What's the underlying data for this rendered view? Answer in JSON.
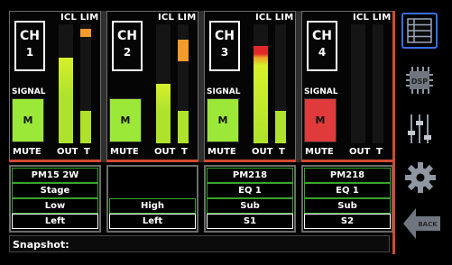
{
  "header": {
    "icl_lim": "ICL LIM"
  },
  "labels": {
    "ch": "CH",
    "signal": "SIGNAL",
    "mute": "MUTE",
    "out": "OUT",
    "t": "T"
  },
  "colors": {
    "meter_green": "#aee22c",
    "meter_yellow": "#d8f02a",
    "peak_orange": "#f39a2c",
    "peak_red": "#e02828",
    "signal_green": "#9be838",
    "signal_red": "#e03a3a",
    "accent_red": "#d04a30",
    "row_border": "#39a32a",
    "selected_icon": "#3a6fe0"
  },
  "channels": [
    {
      "number": "1",
      "signal_symbol": "M",
      "signal_state": "green",
      "out_level": 0.72,
      "t_level": 0.27,
      "lim_indicator": true,
      "out_peak": "none",
      "info": [
        "PM15 2W",
        "Stage",
        "Low",
        "Left"
      ]
    },
    {
      "number": "2",
      "signal_symbol": "M",
      "signal_state": "green",
      "out_level": 0.5,
      "t_level": 0.27,
      "lim_indicator": false,
      "t_peak_level": 0.87,
      "out_peak": "none",
      "info": [
        "",
        "",
        "High",
        "Left"
      ]
    },
    {
      "number": "3",
      "signal_symbol": "M",
      "signal_state": "green",
      "out_level": 0.82,
      "t_level": 0.27,
      "lim_indicator": false,
      "out_peak": "red",
      "info": [
        "PM218",
        "EQ 1",
        "Sub",
        "S1"
      ]
    },
    {
      "number": "4",
      "signal_symbol": "M",
      "signal_state": "red",
      "out_level": 0.0,
      "t_level": 0.0,
      "lim_indicator": false,
      "out_peak": "none",
      "info": [
        "PM218",
        "EQ 1",
        "Sub",
        "S2"
      ]
    }
  ],
  "sidebar": {
    "items": [
      {
        "icon": "channel-list-icon",
        "selected": true
      },
      {
        "icon": "dsp-chip-icon",
        "label": "DSP"
      },
      {
        "icon": "fader-settings-icon"
      },
      {
        "icon": "gear-icon"
      },
      {
        "icon": "back-arrow-icon",
        "label": "BACK"
      }
    ]
  },
  "snapshot": {
    "label": "Snapshot:"
  }
}
